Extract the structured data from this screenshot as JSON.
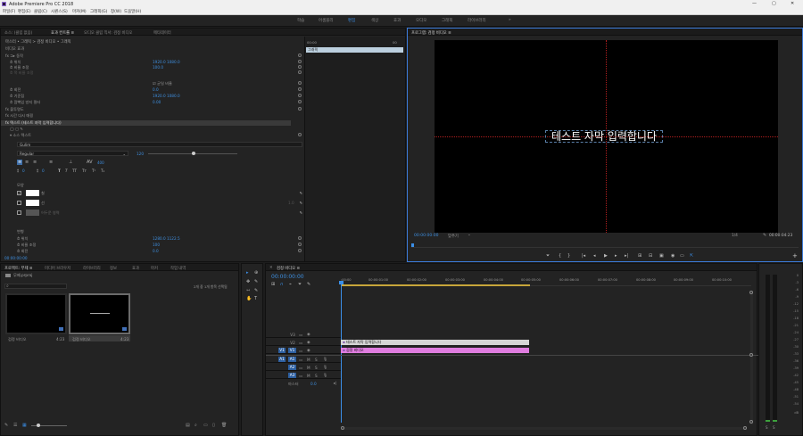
{
  "app": {
    "title": "Adobe Premiere Pro CC 2018"
  },
  "window_controls": [
    "—",
    "▢",
    "✕"
  ],
  "menu": [
    "파일(F)",
    "편집(E)",
    "클립(C)",
    "시퀀스(S)",
    "마커(M)",
    "그래픽(G)",
    "창(W)",
    "도움말(H)"
  ],
  "workspaces": {
    "items": [
      "학습",
      "어셈블리",
      "편집",
      "색상",
      "효과",
      "오디오",
      "그래픽",
      "라이브러리"
    ],
    "active": "편집",
    "more": "»"
  },
  "effect_panel": {
    "tabs": [
      "소스: (클립 없음)",
      "효과 컨트롤 ≡",
      "오디오 클립 믹서: 검정 비디오",
      "메타데이터"
    ],
    "breadcrumb": "마스터 • 그래픽  >  검정 비디오 • 그래픽",
    "section_video": "비디오 효과",
    "rows": [
      {
        "label": "fx  ⊐▸ 동작",
        "value": ""
      },
      {
        "label": "  ⏱ 위치",
        "value": "1920.0   1080.0"
      },
      {
        "label": "  ⏱ 비율 조정",
        "value": "100.0"
      },
      {
        "label": "  ⏱ 폭 비율 조정",
        "value": ""
      },
      {
        "label": "",
        "value": "☑ 균일 비율"
      },
      {
        "label": "  ⏱ 회전",
        "value": "0.0"
      },
      {
        "label": "  ⏱ 기준점",
        "value": "1920.0   1080.0"
      },
      {
        "label": "  ⏱ 깜빡임 방지 필터",
        "value": "0.00"
      },
      {
        "label": "fx  불투명도",
        "value": ""
      },
      {
        "label": "fx  시간 다시 매핑",
        "value": ""
      },
      {
        "label": "fx  텍스트 (테스트 자막 입력합니다)",
        "value": ""
      },
      {
        "label": "  ◯ ▢ ✎",
        "value": ""
      },
      {
        "label": "  ▾ 소스 텍스트",
        "value": ""
      }
    ],
    "font": "Gulim",
    "font_style": "Regular",
    "font_size": "120",
    "kerning_value": "400",
    "tracking_value": "0",
    "leading_value": "0",
    "appearance_label": "모양",
    "fill_label": "칠",
    "stroke_label": "선",
    "shadow_label": "어두운 영역",
    "stroke_value": "1.0",
    "transform_label": "변형",
    "transform_rows": [
      {
        "label": "  ⏱ 위치",
        "value": "1280.0   1122.5"
      },
      {
        "label": "  ⏱ 비율 조정",
        "value": "100"
      },
      {
        "label": "  ⏱ 회전",
        "value": "0.0"
      }
    ],
    "timecode": "00:00:00:00",
    "mini_timeline": {
      "timecode": "00:00",
      "clip_label": "그래픽"
    }
  },
  "program_monitor": {
    "tab": "프로그램: 검정 비디오 ≡",
    "overlay_text": "테스트 자막 입력합니다",
    "timecode": "00:00:00:00",
    "fit": "맞추기",
    "quality": "1/4",
    "duration": "00:00:04:23",
    "controls": [
      "⏷",
      "{",
      "}",
      "|◂",
      "◂|",
      "◂",
      "▶",
      "▸",
      "▸|",
      "⊞",
      "⊟",
      "▣",
      "◉",
      "▭",
      "⇱"
    ],
    "add_button": "+"
  },
  "project_panel": {
    "tabs": [
      "프로젝트: 무제 ≡",
      "미디어 브라우저",
      "라이브러리",
      "정보",
      "효과",
      "마커",
      "작업 내역"
    ],
    "project_name": "무제.prproj",
    "item_count": "2개 중 1개 항목 선택됨",
    "items": [
      {
        "name": "검정 비디오",
        "duration": "4:23"
      },
      {
        "name": "검정 비디오",
        "duration": "4:23"
      }
    ]
  },
  "tools": [
    "▸",
    "⊕",
    "✥",
    "⇿",
    "✎",
    "✋",
    "T"
  ],
  "timeline": {
    "tab": "검정 비디오 ≡",
    "timecode": "00:00:00:00",
    "ruler": [
      ":00:00",
      "00:00:01:00",
      "00:00:02:00",
      "00:00:03:00",
      "00:00:04:00",
      "00:00:05:00",
      "00:00:06:00",
      "00:00:07:00",
      "00:00:08:00",
      "00:00:09:00",
      "00:00:10:00"
    ],
    "tracks": [
      {
        "id": "V3",
        "type": "video"
      },
      {
        "id": "V2",
        "type": "video"
      },
      {
        "id": "V1",
        "type": "video"
      },
      {
        "id": "A1",
        "type": "audio"
      },
      {
        "id": "A2",
        "type": "audio"
      },
      {
        "id": "A3",
        "type": "audio"
      }
    ],
    "master": {
      "label": "마스터",
      "value": "0.0"
    },
    "clips": [
      {
        "track": "V2",
        "label": "테스트 자막 입력합니다",
        "color": "#d6d6d6"
      },
      {
        "track": "V1",
        "label": "검정 비디오",
        "color": "#e07de0"
      }
    ]
  },
  "meters": {
    "labels": [
      "0",
      "-3",
      "-6",
      "-9",
      "-12",
      "-15",
      "-18",
      "-21",
      "-24",
      "-27",
      "-30",
      "-33",
      "-36",
      "-39",
      "-42",
      "-45",
      "-48",
      "-51",
      "-54",
      "dB"
    ],
    "footer": [
      "S",
      "S"
    ]
  }
}
